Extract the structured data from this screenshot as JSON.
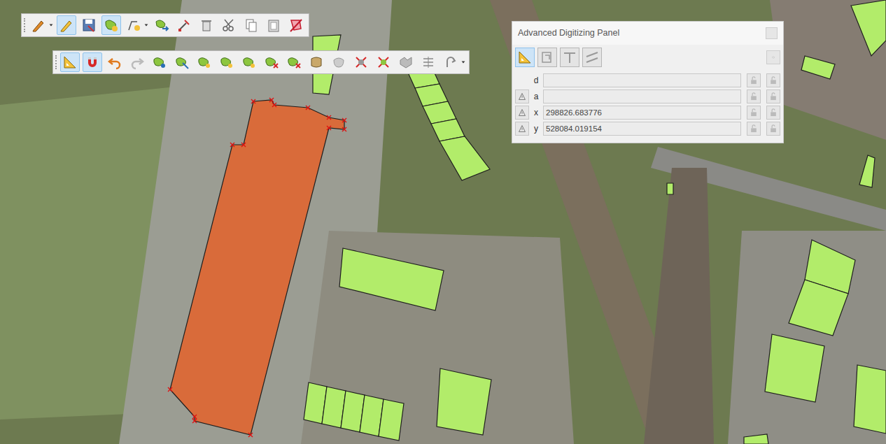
{
  "toolbars": [
    {
      "buttons": [
        {
          "active": false
        },
        {
          "active": true
        },
        {
          "active": false
        },
        {
          "active": true
        },
        {
          "active": false
        },
        {
          "active": false
        },
        {
          "active": false
        },
        {
          "active": false
        },
        {
          "active": false
        },
        {
          "active": false
        },
        {
          "active": false
        },
        {
          "active": false
        }
      ]
    },
    {
      "buttons": [
        {
          "active": true
        },
        {
          "active": true
        },
        {
          "active": false
        },
        {
          "active": false
        },
        {
          "active": false
        },
        {
          "active": false
        },
        {
          "active": false
        },
        {
          "active": false
        },
        {
          "active": false
        },
        {
          "active": false
        },
        {
          "active": false
        },
        {
          "active": false
        },
        {
          "active": false
        },
        {
          "active": false
        },
        {
          "active": false
        },
        {
          "active": false
        },
        {
          "active": false
        },
        {
          "active": false
        }
      ]
    }
  ],
  "panel": {
    "title": "Advanced Digitizing Panel",
    "tools": [
      {
        "active": true
      },
      {
        "active": false
      },
      {
        "active": false
      },
      {
        "active": false
      }
    ],
    "settings": {
      "disabled": true
    },
    "fields": [
      {
        "label": "d",
        "value": "",
        "kind": "plain",
        "locked": false,
        "relative_locked": false
      },
      {
        "label": "a",
        "value": "",
        "kind": "relative",
        "locked": false,
        "relative_locked": false
      },
      {
        "label": "x",
        "value": "298826.683776",
        "kind": "relative",
        "locked": false,
        "relative_locked": false
      },
      {
        "label": "y",
        "value": "528084.019154",
        "kind": "relative",
        "locked": false,
        "relative_locked": false
      }
    ]
  },
  "features": [
    {
      "selected": true
    },
    {
      "selected": false
    },
    {
      "selected": false
    },
    {
      "selected": false
    },
    {
      "selected": false
    },
    {
      "selected": false
    },
    {
      "selected": false
    },
    {
      "selected": false
    },
    {
      "selected": false
    },
    {
      "selected": false
    },
    {
      "selected": false
    },
    {
      "selected": false
    },
    {
      "selected": false
    },
    {
      "selected": false
    },
    {
      "selected": false
    },
    {
      "selected": false
    },
    {
      "selected": false
    },
    {
      "selected": false
    },
    {
      "selected": false
    },
    {
      "selected": false
    },
    {
      "selected": false
    },
    {
      "selected": false
    },
    {
      "selected": false
    }
  ]
}
